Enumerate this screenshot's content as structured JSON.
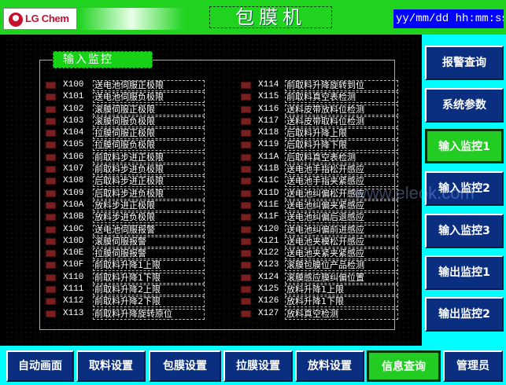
{
  "header": {
    "logo_text": "LG Chem",
    "title": "包膜机",
    "datetime": "yy/mm/dd hh:mm:ss"
  },
  "group": {
    "title": "输入监控"
  },
  "inputs_left": [
    {
      "code": "X100",
      "desc": "送电池伺服正极限"
    },
    {
      "code": "X101",
      "desc": "送电池伺服负极限"
    },
    {
      "code": "X102",
      "desc": "滚膜伺服正极限"
    },
    {
      "code": "X103",
      "desc": "滚膜伺服负极限"
    },
    {
      "code": "X104",
      "desc": "拉膜伺服正极限"
    },
    {
      "code": "X105",
      "desc": "拉膜伺服负极限"
    },
    {
      "code": "X106",
      "desc": "前取料步进正极限"
    },
    {
      "code": "X107",
      "desc": "前取料步进负极限"
    },
    {
      "code": "X108",
      "desc": "后取料步进正极限"
    },
    {
      "code": "X109",
      "desc": "后取料步进负极限"
    },
    {
      "code": "X10A",
      "desc": "放料步进正极限"
    },
    {
      "code": "X10B",
      "desc": "放料步进负极限"
    },
    {
      "code": "X10C",
      "desc": "送电池伺服报警"
    },
    {
      "code": "X10D",
      "desc": "滚膜伺服报警"
    },
    {
      "code": "X10E",
      "desc": "拉膜伺服报警"
    },
    {
      "code": "X10F",
      "desc": "前取料升降1上限"
    },
    {
      "code": "X110",
      "desc": "前取料升降1下限"
    },
    {
      "code": "X111",
      "desc": "前取料升降2上限"
    },
    {
      "code": "X112",
      "desc": "前取料升降2下限"
    },
    {
      "code": "X113",
      "desc": "前取料升降旋转原位"
    }
  ],
  "inputs_right": [
    {
      "code": "X114",
      "desc": "前取料升降旋转到位"
    },
    {
      "code": "X115",
      "desc": "前取料真空表检测"
    },
    {
      "code": "X116",
      "desc": "送料皮带放料位检测"
    },
    {
      "code": "X117",
      "desc": "送料皮带取料位检测"
    },
    {
      "code": "X118",
      "desc": "后取料升降上限"
    },
    {
      "code": "X119",
      "desc": "后取料升降下限"
    },
    {
      "code": "X11A",
      "desc": "后取料真空表检测"
    },
    {
      "code": "X11B",
      "desc": "送电池手指松开感应"
    },
    {
      "code": "X11C",
      "desc": "送电池手指夹紧感应"
    },
    {
      "code": "X11D",
      "desc": "送电池纠偏松开感应"
    },
    {
      "code": "X11E",
      "desc": "送电池纠偏夹紧感应"
    },
    {
      "code": "X11F",
      "desc": "送电池纠偏后退感应"
    },
    {
      "code": "X120",
      "desc": "送电池纠偏前进感应"
    },
    {
      "code": "X121",
      "desc": "送电池夹模松开感应"
    },
    {
      "code": "X122",
      "desc": "送电池夹紧夹紧感应"
    },
    {
      "code": "X123",
      "desc": "滚膜包膜位产品检测"
    },
    {
      "code": "X124",
      "desc": "滚膜感应膜纠偏位置"
    },
    {
      "code": "X125",
      "desc": "放料升降1上限"
    },
    {
      "code": "X126",
      "desc": "放料升降1下限"
    },
    {
      "code": "X127",
      "desc": "放料真空检测"
    }
  ],
  "side_nav": [
    {
      "label": "报警查询"
    },
    {
      "label": "系统参数"
    },
    {
      "label": "输入监控1"
    },
    {
      "label": "输入监控2"
    },
    {
      "label": "输入监控3"
    },
    {
      "label": "输出监控1"
    },
    {
      "label": "输出监控2"
    }
  ],
  "bottom_tabs": [
    {
      "label": "自动画面"
    },
    {
      "label": "取料设置"
    },
    {
      "label": "包膜设置"
    },
    {
      "label": "拉膜设置"
    },
    {
      "label": "放料设置"
    },
    {
      "label": "信息查询"
    },
    {
      "label": "管理员"
    }
  ],
  "watermark": "www.eleok.com",
  "colors": {
    "header_green": "#1fd31f",
    "nav_blue": "#0a2f80",
    "active_green": "#22cc22",
    "panel_cyan": "#00ffff",
    "datetime_blue": "#0000ff",
    "led_off": "#7a1f1f"
  }
}
